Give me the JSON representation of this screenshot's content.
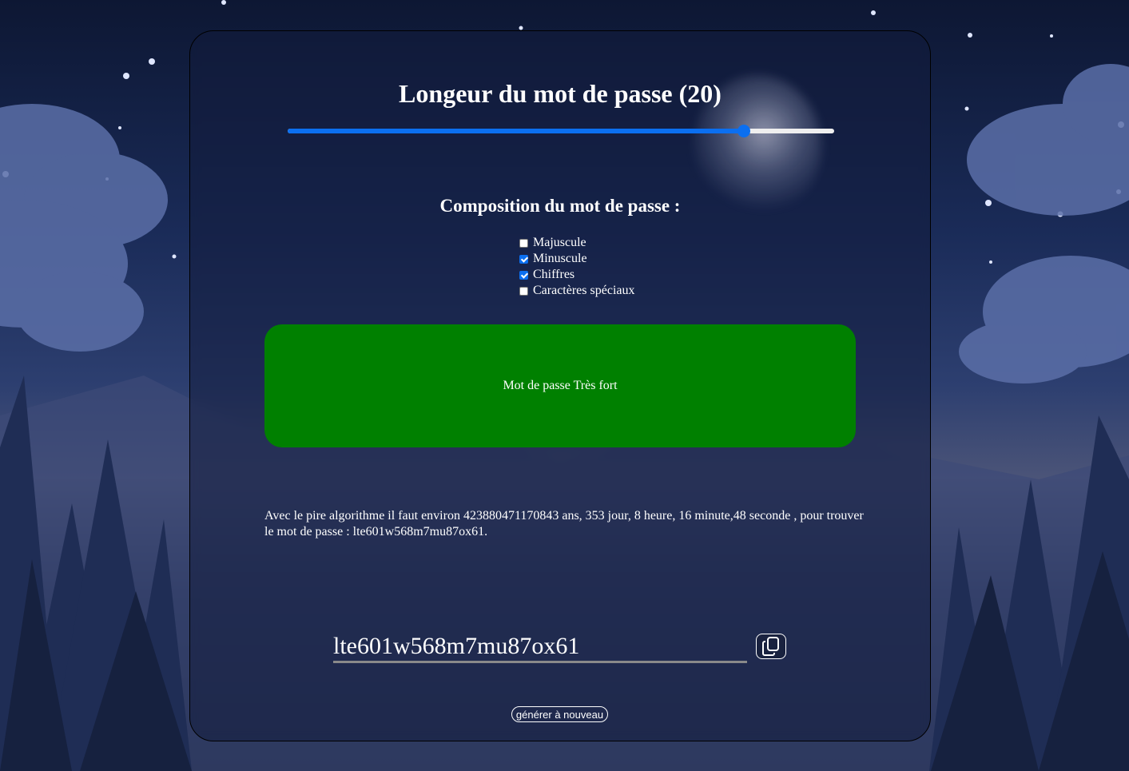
{
  "length_title": "Longeur du mot de passe (20)",
  "length_slider": {
    "value": 20,
    "fill_fraction": 0.835
  },
  "composition_title": "Composition du mot de passe :",
  "options": [
    {
      "label": "Majuscule",
      "checked": false
    },
    {
      "label": "Minuscule",
      "checked": true
    },
    {
      "label": "Chiffres",
      "checked": true
    },
    {
      "label": "Caractères spéciaux",
      "checked": false
    }
  ],
  "strength": {
    "label": "Mot de passe Très fort",
    "color": "#008000"
  },
  "crack_time_text": "Avec le pire algorithme il faut environ 423880471170843 ans, 353 jour, 8 heure, 16 minute,48 seconde , pour trouver le mot de passe : lte601w568m7mu87ox61.",
  "password": {
    "value": "lte601w568m7mu87ox61"
  },
  "copy_icon": "copy-icon",
  "regenerate_label": "générer à nouveau",
  "accent_color": "#0b6ff0"
}
